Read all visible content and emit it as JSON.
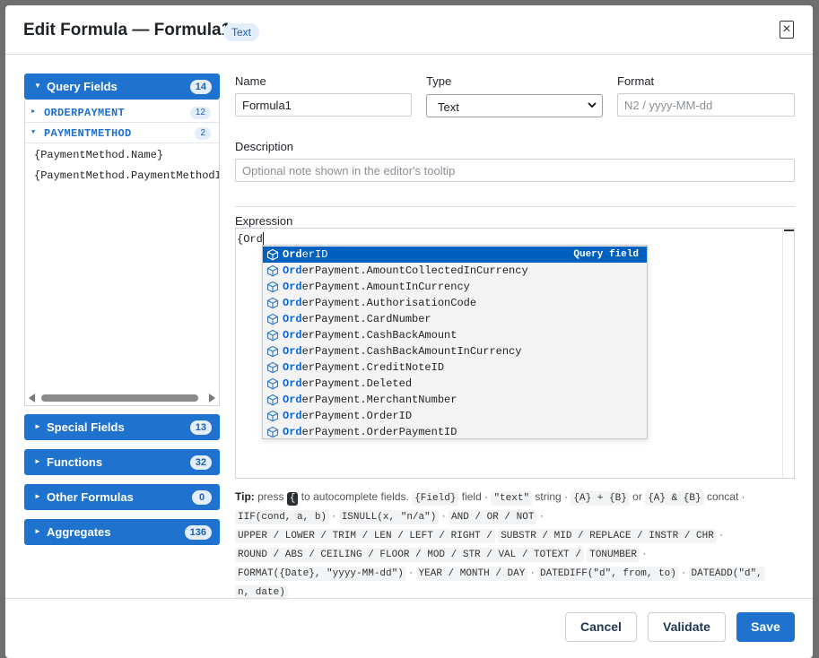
{
  "dialog": {
    "title": "Edit Formula — Formula1",
    "badge": "Text",
    "close_glyph": "×"
  },
  "left_panel": {
    "query_fields": {
      "label": "Query Fields",
      "count": "14",
      "groups": [
        {
          "label": "ORDERPAYMENT",
          "count": "12",
          "expanded": false
        },
        {
          "label": "PAYMENTMETHOD",
          "count": "2",
          "expanded": true
        }
      ],
      "fields": [
        "{PaymentMethod.Name}",
        "{PaymentMethod.PaymentMethodID}"
      ]
    },
    "sections": [
      {
        "label": "Special Fields",
        "count": "13"
      },
      {
        "label": "Functions",
        "count": "32"
      },
      {
        "label": "Other Formulas",
        "count": "0"
      },
      {
        "label": "Aggregates",
        "count": "136"
      }
    ]
  },
  "form": {
    "name_label": "Name",
    "name_value": "Formula1",
    "type_label": "Type",
    "type_value": "Text",
    "format_label": "Format",
    "format_placeholder": "N2 / yyyy-MM-dd",
    "description_label": "Description",
    "description_placeholder": "Optional note shown in the editor's tooltip",
    "expression_label": "Expression",
    "expression_value": "{Ord"
  },
  "autocomplete": {
    "match": "Ord",
    "selected_kind": "Query field",
    "items": [
      {
        "prefix": "Ord",
        "rest": "erID"
      },
      {
        "prefix": "Ord",
        "rest": "erPayment.AmountCollectedInCurrency"
      },
      {
        "prefix": "Ord",
        "rest": "erPayment.AmountInCurrency"
      },
      {
        "prefix": "Ord",
        "rest": "erPayment.AuthorisationCode"
      },
      {
        "prefix": "Ord",
        "rest": "erPayment.CardNumber"
      },
      {
        "prefix": "Ord",
        "rest": "erPayment.CashBackAmount"
      },
      {
        "prefix": "Ord",
        "rest": "erPayment.CashBackAmountInCurrency"
      },
      {
        "prefix": "Ord",
        "rest": "erPayment.CreditNoteID"
      },
      {
        "prefix": "Ord",
        "rest": "erPayment.Deleted"
      },
      {
        "prefix": "Ord",
        "rest": "erPayment.MerchantNumber"
      },
      {
        "prefix": "Ord",
        "rest": "erPayment.OrderID"
      },
      {
        "prefix": "Ord",
        "rest": "erPayment.OrderPaymentID"
      }
    ]
  },
  "tip": {
    "lead": "Tip:",
    "press": "press",
    "key": "{",
    "to_autocomplete": "to autocomplete fields.",
    "field_code": "{Field}",
    "field_word": "field",
    "text_code": "\"text\"",
    "string_word": "string",
    "concat1": "{A} + {B}",
    "or_word": "or",
    "concat2": "{A} & {B}",
    "concat_word": "concat",
    "codes": [
      "IIF(cond, a, b)",
      "ISNULL(x, \"n/a\")",
      "AND / OR / NOT",
      "UPPER / LOWER / TRIM / LEN / LEFT / RIGHT /",
      "SUBSTR / MID / REPLACE / INSTR / CHR",
      "ROUND / ABS / CEILING / FLOOR / MOD / STR / VAL / TOTEXT /",
      "TONUMBER",
      "FORMAT({Date}, \"yyyy-MM-dd\")",
      "YEAR / MONTH / DAY",
      "DATEDIFF(\"d\", from, to)",
      "DATEADD(\"d\",",
      "n, date)"
    ]
  },
  "footer": {
    "cancel": "Cancel",
    "validate": "Validate",
    "save": "Save"
  },
  "colors": {
    "accent": "#1f73cf",
    "selection": "#0060c0",
    "badge_bg": "#e4eefb"
  }
}
